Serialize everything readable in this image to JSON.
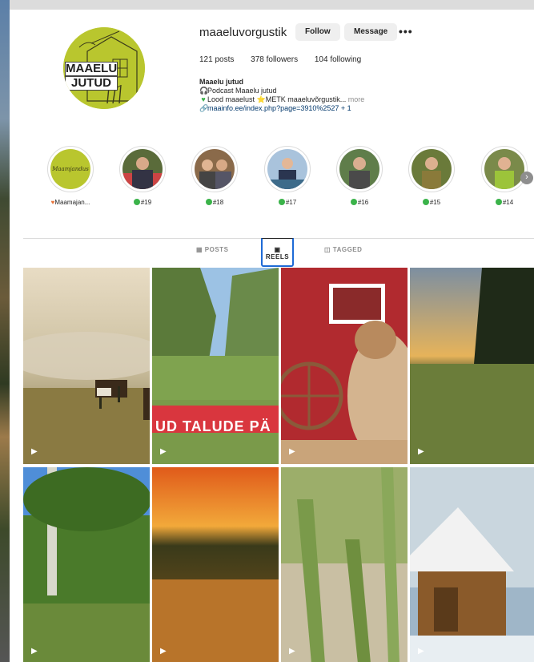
{
  "profile": {
    "avatar_text_line1": "MAAELU",
    "avatar_text_line2": "JUTUD",
    "username": "maaeluvorgustik",
    "follow_label": "Follow",
    "message_label": "Message",
    "more_options": "•••",
    "posts": "121 posts",
    "followers": "378 followers",
    "following": "104 following",
    "bio_name": "Maaelu jutud",
    "bio_line1": "Podcast Maaelu jutud",
    "bio_line2": "Lood maaelust ⭐METK maaeluvõrgustik...",
    "bio_more": "more",
    "bio_link": "maainfo.ee/index.php?page=3910%2527 + 1"
  },
  "highlights": [
    {
      "label": "Maamajan...",
      "marker": "heart",
      "cover_text": "Maamjandus"
    },
    {
      "label": "#19",
      "marker": "dot"
    },
    {
      "label": "#18",
      "marker": "dot"
    },
    {
      "label": "#17",
      "marker": "dot"
    },
    {
      "label": "#16",
      "marker": "dot"
    },
    {
      "label": "#15",
      "marker": "dot"
    },
    {
      "label": "#14",
      "marker": "dot"
    }
  ],
  "tabs": {
    "posts": "POSTS",
    "reels": "REELS",
    "tagged": "TAGGED",
    "active": "reels"
  },
  "reels": [
    {
      "scene": "misty pasture with cows"
    },
    {
      "scene": "farm day banner",
      "banner_text": "UD TALUDE PÄ"
    },
    {
      "scene": "cat by red barn"
    },
    {
      "scene": "sunset field"
    },
    {
      "scene": "birch tree garden"
    },
    {
      "scene": "sunset grass"
    },
    {
      "scene": "asparagus"
    },
    {
      "scene": "snowy log cabin"
    }
  ],
  "colors": {
    "accent_blue": "#0095f6",
    "link": "#00376b",
    "green_dot": "#3bb34a",
    "avatar_green": "#b9c62e",
    "tab_focus": "#1e6ad6"
  },
  "icons": {
    "more": "more-horizontal-icon",
    "podcast": "headphones-icon",
    "heart": "green-heart-icon",
    "link": "link-icon",
    "reel": "play-icon",
    "next": "chevron-right-icon"
  }
}
